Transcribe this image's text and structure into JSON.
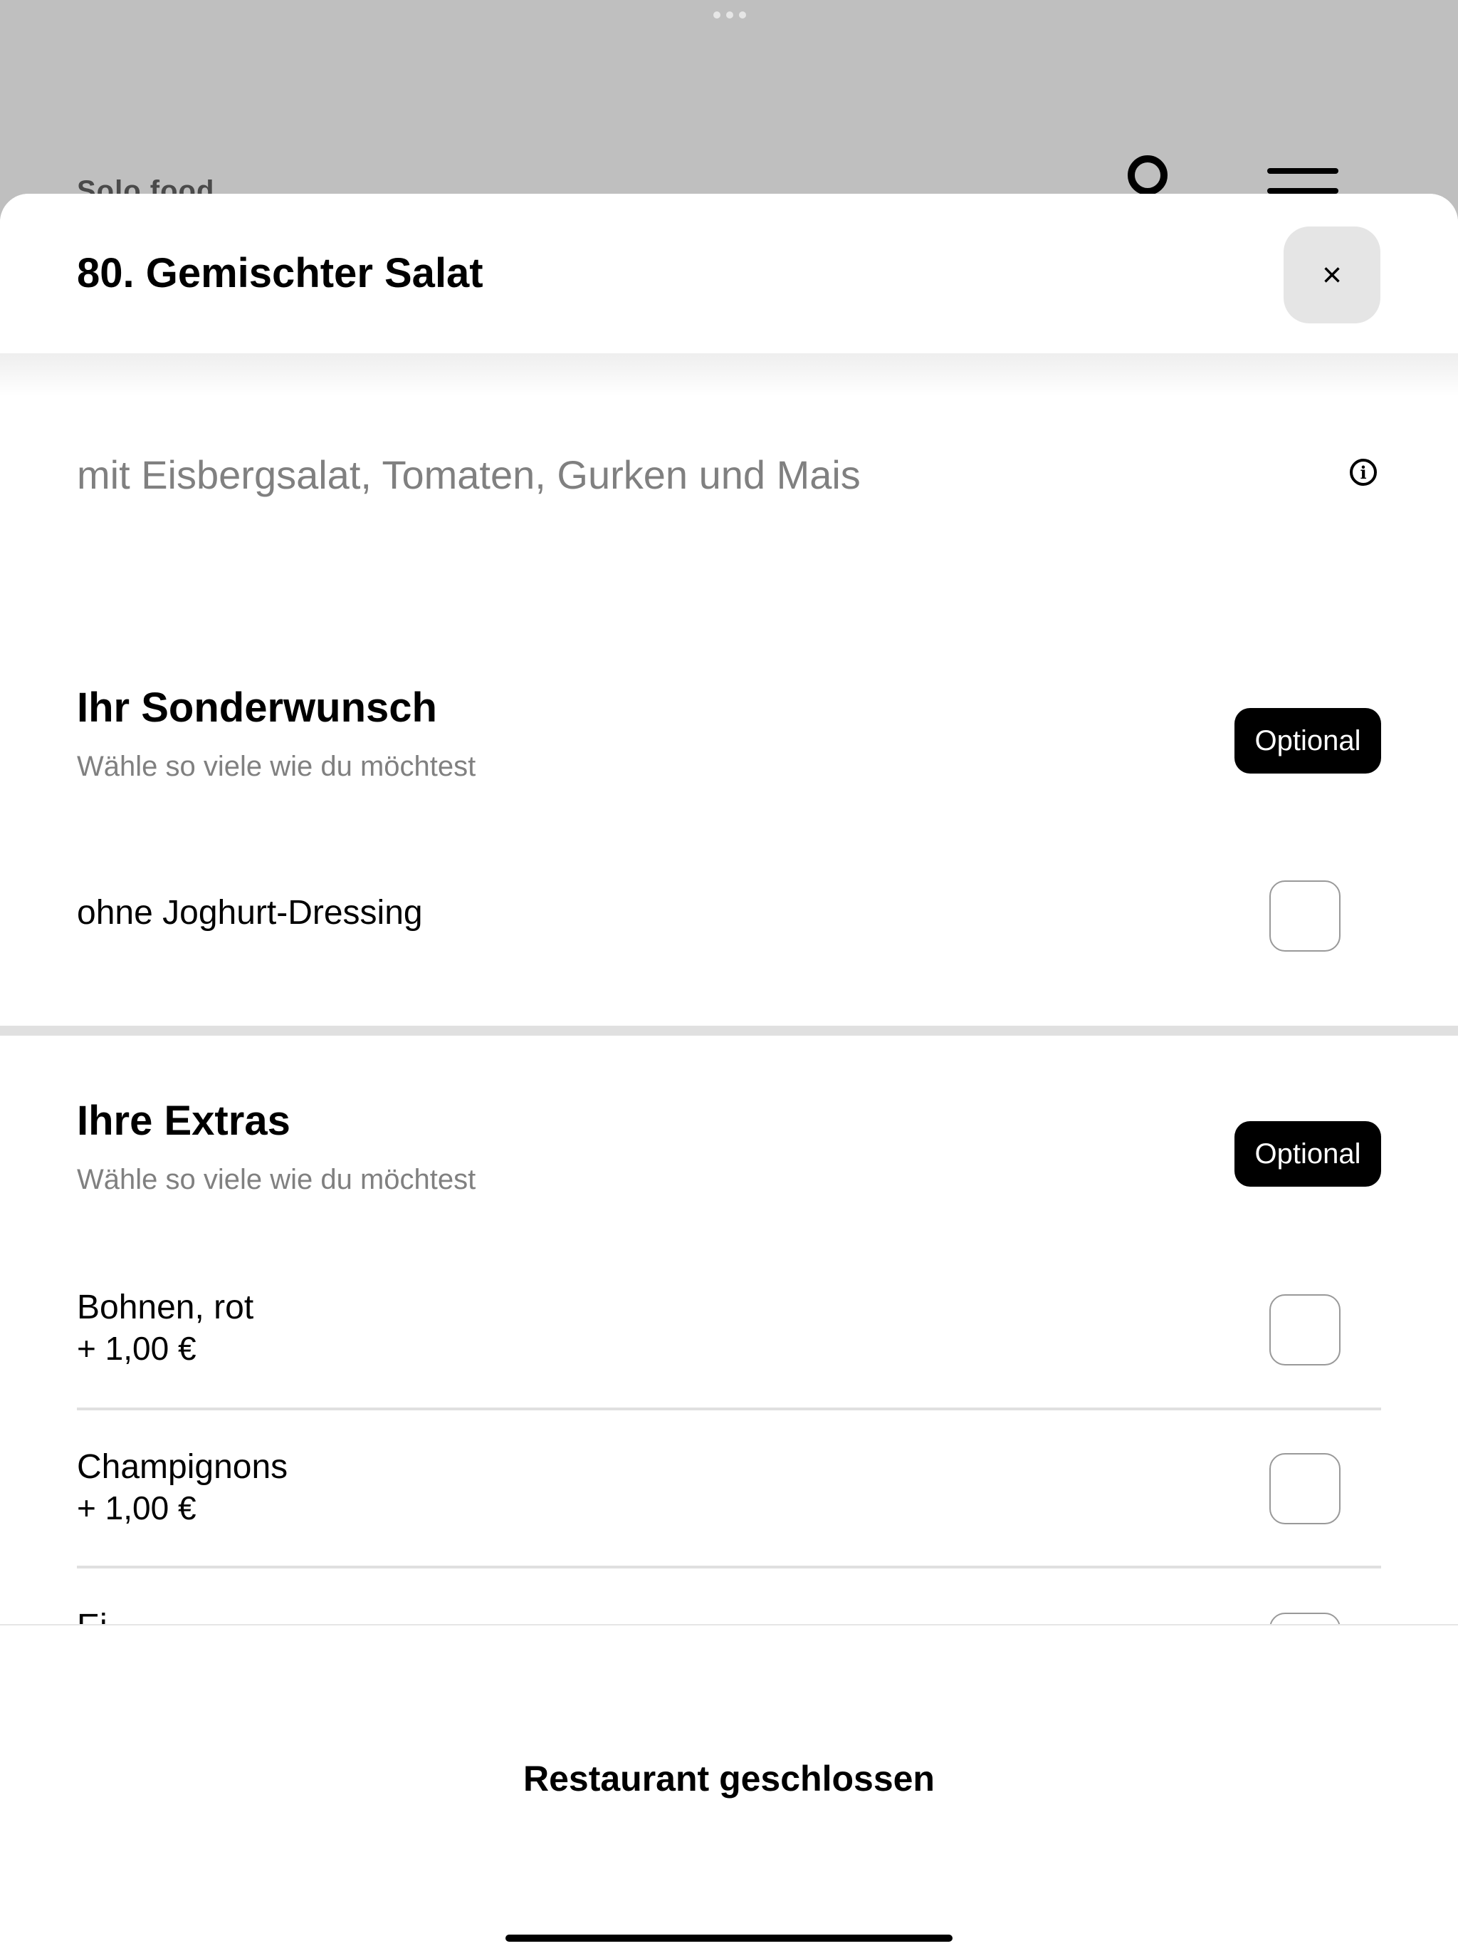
{
  "background_app": {
    "title": "Solo food",
    "user_icon": "user-circle-icon",
    "menu_icon": "hamburger-menu-icon"
  },
  "product": {
    "title": "80. Gemischter Salat",
    "description": "mit Eisbergsalat, Tomaten, Gurken und Mais",
    "close_icon": "×",
    "info_icon": "i"
  },
  "sections": [
    {
      "title": "Ihr Sonderwunsch",
      "subtitle": "Wähle so viele wie du möchtest",
      "badge": "Optional",
      "options": [
        {
          "name": "ohne Joghurt-Dressing",
          "checked": false
        }
      ]
    },
    {
      "title": "Ihre Extras",
      "subtitle": "Wähle so viele wie du möchtest",
      "badge": "Optional",
      "options": [
        {
          "name": "Bohnen, rot",
          "price": "+ 1,00 €",
          "checked": false
        },
        {
          "name": "Champignons",
          "price": "+ 1,00 €",
          "checked": false
        },
        {
          "name": "Ei",
          "checked": false
        }
      ]
    }
  ],
  "footer": {
    "status": "Restaurant geschlossen"
  }
}
